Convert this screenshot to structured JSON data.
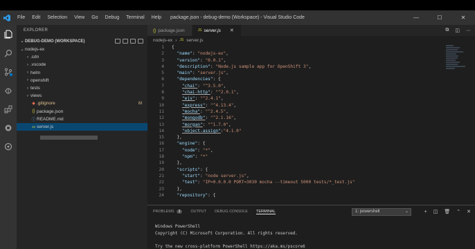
{
  "titlebar": {
    "menu": [
      "File",
      "Edit",
      "Selection",
      "View",
      "Go",
      "Debug",
      "Terminal",
      "Help"
    ],
    "title": "package.json - debug-demo (Workspace) - Visual Studio Code",
    "controls": {
      "minimize": "—",
      "maximize": "☐",
      "close": "✕"
    }
  },
  "sidebar": {
    "header": "EXPLORER",
    "workspace": "DEBUG-DEMO (WORKSPACE)",
    "items": [
      {
        "label": "nodejs-ex",
        "chev": "⌄",
        "icon": "",
        "git": ""
      },
      {
        "label": ".cdn",
        "chev": "›",
        "icon": "",
        "git": ""
      },
      {
        "label": ".vscode",
        "chev": "›",
        "icon": "",
        "git": ""
      },
      {
        "label": "helm",
        "chev": "›",
        "icon": "",
        "git": ""
      },
      {
        "label": "openshift",
        "chev": "›",
        "icon": "",
        "git": ""
      },
      {
        "label": "tests",
        "chev": "›",
        "icon": "",
        "git": ""
      },
      {
        "label": "views",
        "chev": "›",
        "icon": "",
        "git": ""
      },
      {
        "label": ".gitignore",
        "chev": "",
        "icon": "◆",
        "git": "M"
      },
      {
        "label": "package.json",
        "chev": "",
        "icon": "{}",
        "git": ""
      },
      {
        "label": "README.md",
        "chev": "",
        "icon": "ⓘ",
        "git": ""
      },
      {
        "label": "server.js",
        "chev": "",
        "icon": "JS",
        "git": ""
      }
    ]
  },
  "editor": {
    "tabs": [
      {
        "label": "package.json",
        "icon": "{}",
        "active": false
      },
      {
        "label": "server.js",
        "icon": "JS",
        "active": true,
        "close": "✕"
      }
    ],
    "breadcrumb": {
      "folder": "nodejs-ex",
      "sep": "›",
      "file": "server.js"
    },
    "lines": [
      {
        "n": "1",
        "text": "{"
      },
      {
        "n": "2",
        "text": "  \"name\": \"nodejs-ex\","
      },
      {
        "n": "3",
        "text": "  \"version\": \"0.0.1\","
      },
      {
        "n": "4",
        "text": "  \"description\": \"Node.js sample app for OpenShift 3\","
      },
      {
        "n": "5",
        "text": "  \"main\": \"server.js\","
      },
      {
        "n": "6",
        "text": "  \"dependencies\": {"
      },
      {
        "n": "7",
        "text": "    \"chai\": \"^3.5.0\","
      },
      {
        "n": "8",
        "text": "    \"chai-http\": \"^2.0.1\","
      },
      {
        "n": "9",
        "text": "    \"ejs\": \"^2.4.1\","
      },
      {
        "n": "10",
        "text": "    \"express\": \"^4.13.4\","
      },
      {
        "n": "11",
        "text": "    \"mocha\": \"^2.4.5\","
      },
      {
        "n": "12",
        "text": "    \"mongodb\": \"^2.1.16\","
      },
      {
        "n": "13",
        "text": "    \"morgan\": \"^1.7.0\","
      },
      {
        "n": "14",
        "text": "    \"object-assign\":\"4.1.0\""
      },
      {
        "n": "15",
        "text": "  },"
      },
      {
        "n": "16",
        "text": "  \"engine\": {"
      },
      {
        "n": "17",
        "text": "    \"node\": \"*\","
      },
      {
        "n": "18",
        "text": "    \"npm\": \"*\""
      },
      {
        "n": "19",
        "text": "  },"
      },
      {
        "n": "20",
        "text": "  \"scripts\": {"
      },
      {
        "n": "21",
        "text": "    \"start\": \"node server.js\","
      },
      {
        "n": "22",
        "text": "    \"test\": \"IP=0.0.0.0 PORT=3030 mocha --timeout 5000 tests/*_test.js\""
      },
      {
        "n": "23",
        "text": "  },"
      },
      {
        "n": "24",
        "text": "  \"repository\": {"
      }
    ]
  },
  "panel": {
    "tabs": [
      "PROBLEMS",
      "OUTPUT",
      "DEBUG CONSOLE",
      "TERMINAL"
    ],
    "problems_count": "3",
    "active_tab": "TERMINAL",
    "terminal_select": "1: powershell",
    "terminal_lines": [
      "Windows PowerShell",
      "Copyright (C) Microsoft Corporation. All rights reserved.",
      "",
      "Try the new cross-platform PowerShell https://aka.ms/pscore6"
    ]
  },
  "colors": {
    "accent": "#007acc",
    "selection": "#094771",
    "string": "#ce9178",
    "key": "#9cdcfe"
  }
}
